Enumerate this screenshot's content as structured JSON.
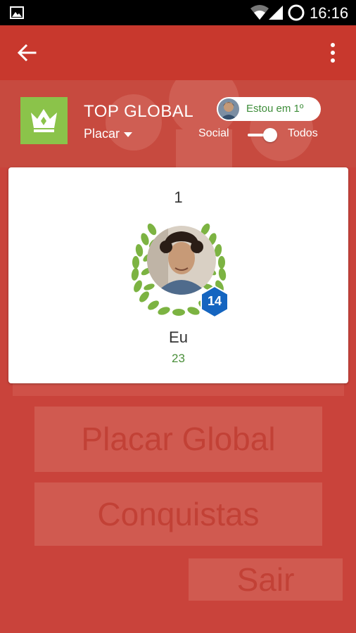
{
  "status_bar": {
    "time": "16:16"
  },
  "header": {
    "title": "TOP GLOBAL",
    "subtitle": "Placar",
    "rank_pill": "Estou em 1º",
    "toggle_left": "Social",
    "toggle_right": "Todos",
    "toggle_on": true
  },
  "card": {
    "rank": "1",
    "level": "14",
    "name": "Eu",
    "score": "23"
  },
  "buttons": {
    "placar_global": "Placar Global",
    "conquistas": "Conquistas",
    "sair": "Sair"
  },
  "colors": {
    "appbar": "#c8382d",
    "background": "#c9433b",
    "crown_tile": "#8bc34a",
    "laurel": "#7cb342",
    "level_badge": "#1565c0",
    "score_green": "#4a8f3a"
  },
  "icons": [
    "image-icon",
    "wifi-icon",
    "signal-icon",
    "battery-icon",
    "back-arrow-icon",
    "more-vert-icon",
    "crown-icon",
    "caret-down-icon",
    "laurel-icon"
  ]
}
